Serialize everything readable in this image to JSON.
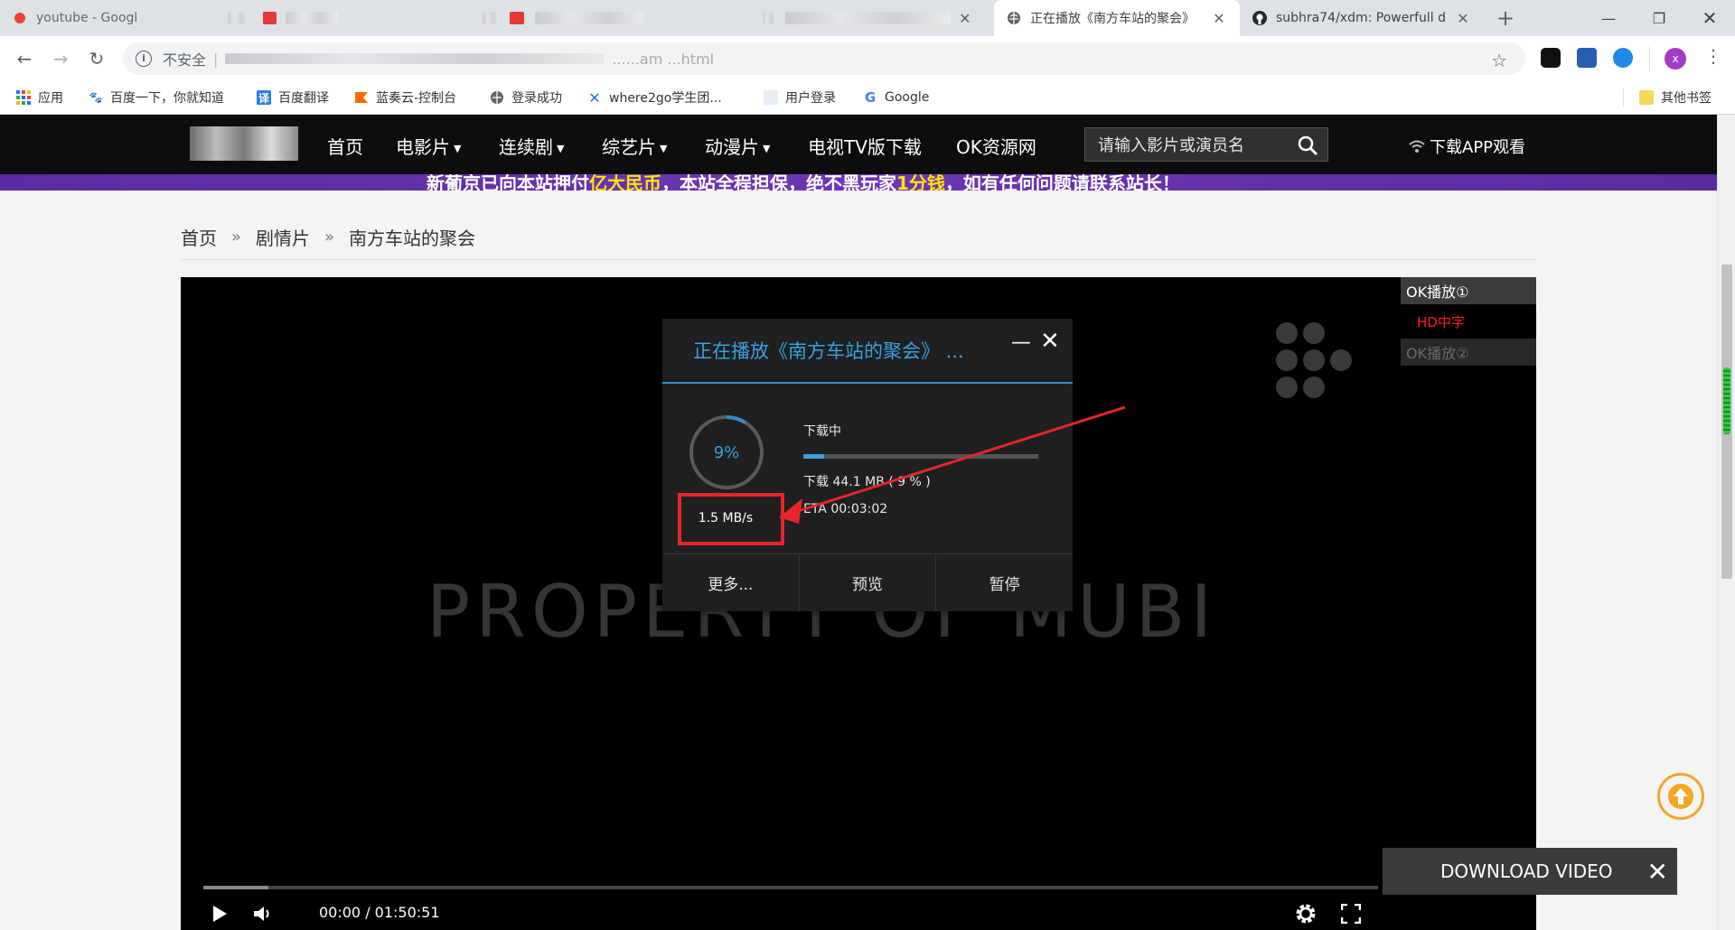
{
  "browser": {
    "tabs": [
      {
        "title": "youtube - Googl",
        "state": "partially-obscured"
      },
      {
        "title": "",
        "state": "obscured"
      },
      {
        "title": "",
        "state": "obscured"
      },
      {
        "title": "",
        "state": "obscured"
      },
      {
        "title": "正在播放《南方车站的聚会》",
        "active": true
      },
      {
        "title": "subhra74/xdm: Powerfull d"
      }
    ],
    "address": {
      "security_label": "不安全",
      "url": "......am ...html"
    },
    "bookmarks": [
      "应用",
      "百度一下，你就知道",
      "百度翻译",
      "蓝奏云-控制台",
      "登录成功",
      "where2go学生团...",
      "用户登录",
      "Google"
    ],
    "other_bookmarks": "其他书签",
    "profile_initial": "x"
  },
  "site": {
    "nav": [
      "首页",
      "电影片",
      "连续剧",
      "综艺片",
      "动漫片",
      "电视TV版下载",
      "OK资源网"
    ],
    "nav_dropdowns": [
      false,
      true,
      true,
      true,
      true,
      false,
      false
    ],
    "search_placeholder": "请输入影片或演员名",
    "app_download": "下载APP观看",
    "banner": {
      "text_a": "新葡京已向本站押付",
      "highlight_a": "亿大民币",
      "text_b": "，本站全程担保，绝不黑玩家",
      "highlight_b": "1分钱",
      "text_c": "，如有任何问题请联系站长！"
    },
    "breadcrumb": [
      "首页",
      "剧情片",
      "南方车站的聚会"
    ],
    "breadcrumb_sep": "»"
  },
  "player": {
    "watermark": "PROPERTY OF MUBI",
    "sources": [
      {
        "label": "OK播放①",
        "state": "active"
      },
      {
        "label": "HD中字",
        "state": "episode"
      },
      {
        "label": "OK播放②",
        "state": "inactive"
      }
    ],
    "time": "00:00 / 01:50:51",
    "buffered_fraction": 0.055
  },
  "download_dialog": {
    "title": "正在播放《南方车站的聚会》 ...",
    "percent_label": "9%",
    "progress_fraction": 0.09,
    "status": "下载中",
    "downloaded": "下载 44.1 MB ( 9 % )",
    "eta": "ETA 00:03:02",
    "speed": "1.5 MB/s",
    "buttons": [
      "更多...",
      "预览",
      "暂停"
    ]
  },
  "download_video_bar": {
    "label": "DOWNLOAD VIDEO"
  },
  "colors": {
    "accent_blue": "#3aa0e0",
    "highlight_red": "#e5262a",
    "nav_bg": "#0d0d0d",
    "banner_purple": "#5b2aa0",
    "totop_orange": "#f5a623"
  },
  "icons": [
    "back-icon",
    "forward-icon",
    "reload-icon",
    "info-icon",
    "star-icon",
    "search-icon",
    "wifi-icon",
    "play-icon",
    "volume-icon",
    "settings-icon",
    "fullscreen-icon",
    "arrow-up-icon",
    "close-icon",
    "minimize-icon"
  ]
}
